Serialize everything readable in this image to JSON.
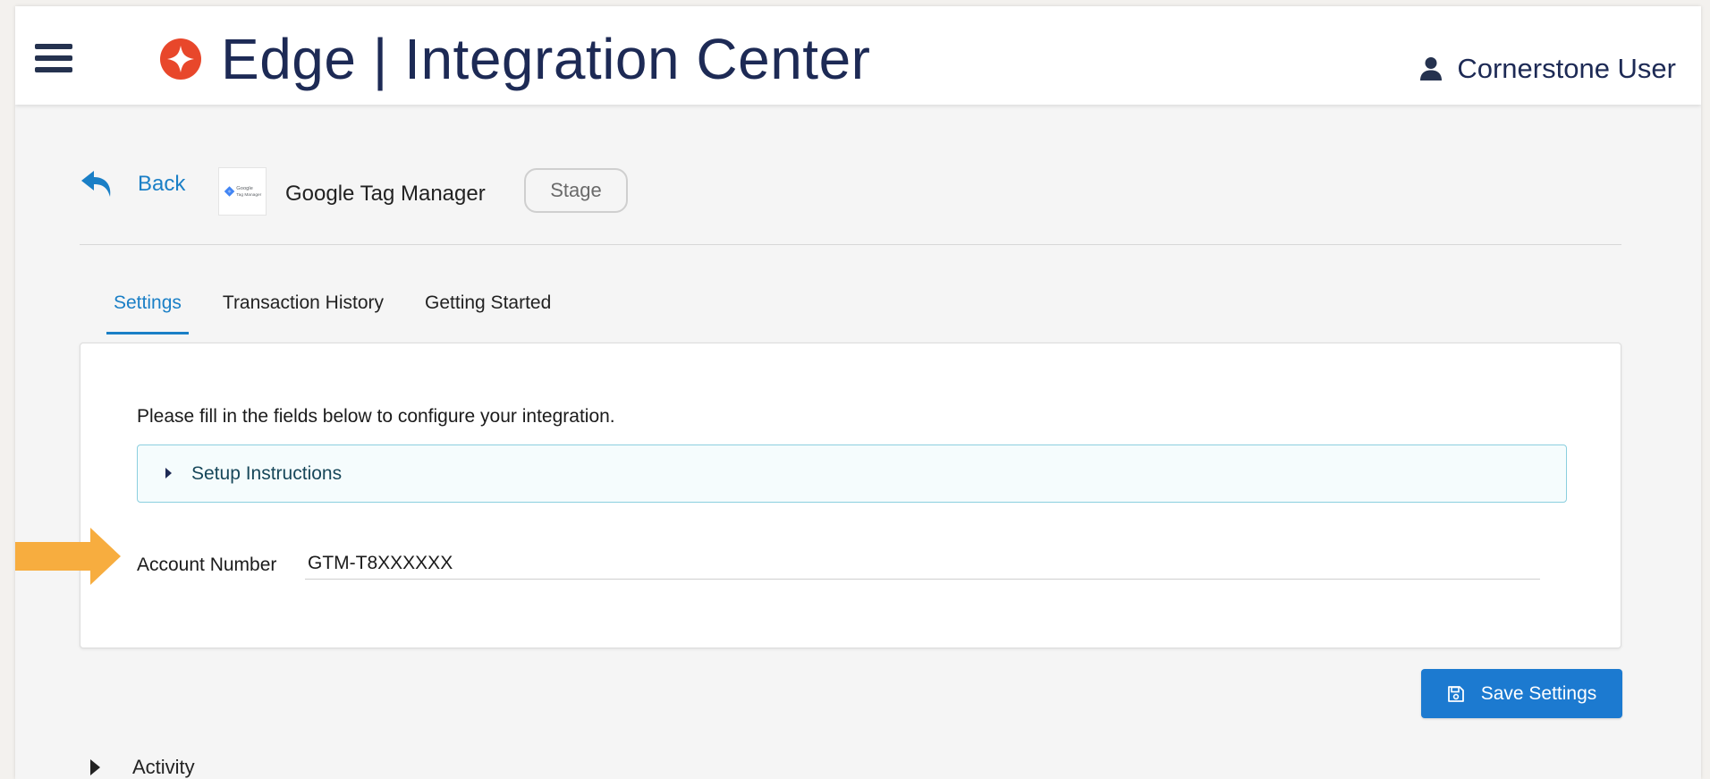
{
  "app": {
    "title": "Edge | Integration Center",
    "user_name": "Cornerstone User",
    "menu_icon": "hamburger-menu-icon",
    "logo_icon": "edge-star-logo",
    "user_icon": "user-person-icon"
  },
  "header": {
    "back_label": "Back",
    "back_icon": "reply-arrow-icon",
    "integration_name": "Google Tag Manager",
    "integration_logo_text": "Google Tag Manager",
    "environment_badge": "Stage"
  },
  "tabs": [
    {
      "label": "Settings",
      "active": true
    },
    {
      "label": "Transaction History",
      "active": false
    },
    {
      "label": "Getting Started",
      "active": false
    }
  ],
  "settings": {
    "intro": "Please fill in the fields below to configure your integration.",
    "setup_instructions_label": "Setup Instructions",
    "account_number_label": "Account Number",
    "account_number_value": "GTM-T8XXXXXX"
  },
  "actions": {
    "save_label": "Save Settings",
    "save_icon": "floppy-disk-icon"
  },
  "activity": {
    "label": "Activity"
  },
  "colors": {
    "brand_navy": "#1d2a55",
    "link_blue": "#1a7fc6",
    "button_blue": "#1c7ad0",
    "logo_orange": "#e8472b",
    "callout_arrow": "#f7ad3f",
    "setup_border": "#8bcfdf"
  }
}
